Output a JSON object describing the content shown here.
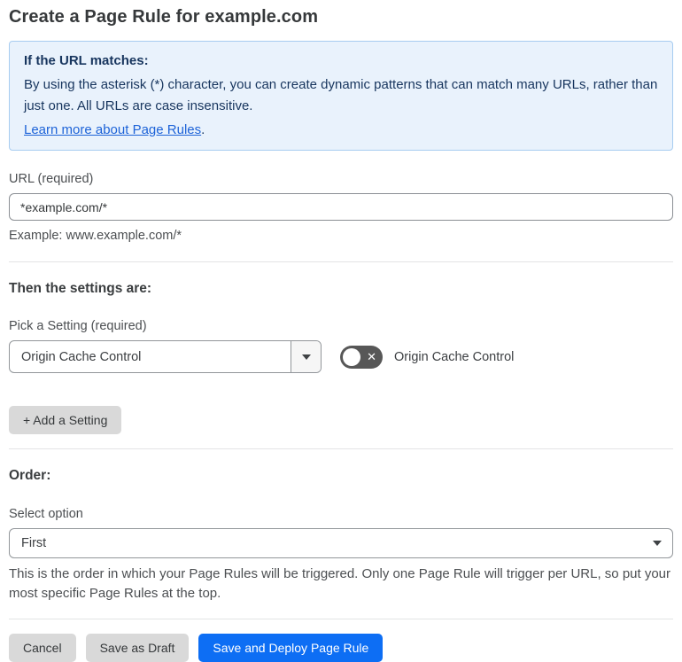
{
  "page": {
    "title": "Create a Page Rule for example.com"
  },
  "info_box": {
    "heading": "If the URL matches:",
    "body": "By using the asterisk (*) character, you can create dynamic patterns that can match many URLs, rather than just one. All URLs are case insensitive.",
    "link_text": "Learn more about Page Rules",
    "link_suffix": "."
  },
  "url_field": {
    "label": "URL (required)",
    "value": "*example.com/*",
    "example": "Example: www.example.com/*"
  },
  "settings": {
    "heading": "Then the settings are:",
    "pick_label": "Pick a Setting (required)",
    "selected_setting": "Origin Cache Control",
    "toggle_state": "off",
    "toggle_icon_glyph": "✕",
    "toggle_label": "Origin Cache Control",
    "add_button_label": "+ Add a Setting"
  },
  "order": {
    "heading": "Order:",
    "label": "Select option",
    "selected_option": "First",
    "help": "This is the order in which your Page Rules will be triggered. Only one Page Rule will trigger per URL, so put your most specific Page Rules at the top."
  },
  "actions": {
    "cancel_label": "Cancel",
    "save_draft_label": "Save as Draft",
    "save_deploy_label": "Save and Deploy Page Rule"
  },
  "colors": {
    "primary_blue": "#0d6ef4",
    "info_background": "#e9f2fc",
    "info_border": "#a7ccf0",
    "info_text": "#17355e",
    "link_blue": "#1d63d8",
    "toggle_off_gray": "#575757",
    "button_gray": "#d9d9d9"
  }
}
